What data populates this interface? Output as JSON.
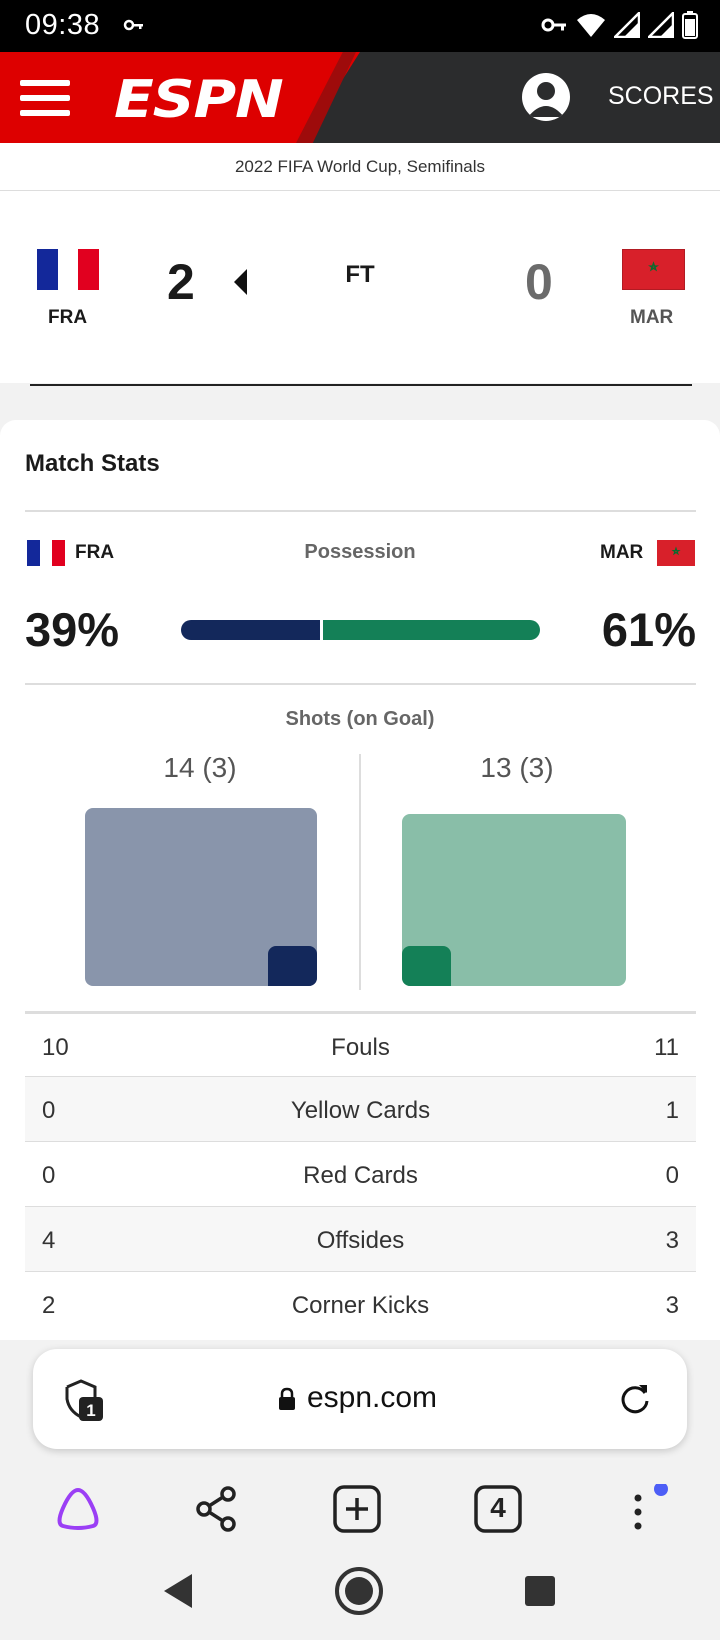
{
  "status_bar": {
    "time": "09:38"
  },
  "header": {
    "brand": "ESPN",
    "scores_label": "SCORES"
  },
  "tournament": "2022 FIFA World Cup, Semifinals",
  "match": {
    "home": {
      "abbr": "FRA",
      "score": "2"
    },
    "away": {
      "abbr": "MAR",
      "score": "0"
    },
    "status": "FT"
  },
  "stats": {
    "title": "Match Stats",
    "possession": {
      "label": "Possession",
      "home_pct": "39%",
      "away_pct": "61%",
      "home_value": 39,
      "away_value": 61
    },
    "shots": {
      "label": "Shots (on Goal)",
      "home_text": "14 (3)",
      "away_text": "13 (3)",
      "home_total": 14,
      "home_on_goal": 3,
      "away_total": 13,
      "away_on_goal": 3
    },
    "rows": [
      {
        "home": "10",
        "name": "Fouls",
        "away": "11"
      },
      {
        "home": "0",
        "name": "Yellow Cards",
        "away": "1"
      },
      {
        "home": "0",
        "name": "Red Cards",
        "away": "0"
      },
      {
        "home": "4",
        "name": "Offsides",
        "away": "3"
      },
      {
        "home": "2",
        "name": "Corner Kicks",
        "away": "3"
      }
    ]
  },
  "browser": {
    "url": "espn.com",
    "shield_count": "1",
    "tab_count": "4"
  },
  "colors": {
    "espn_red": "#dd0000",
    "header_dark": "#2b2c2d",
    "france_navy": "#13285b",
    "morocco_green": "#148057"
  }
}
